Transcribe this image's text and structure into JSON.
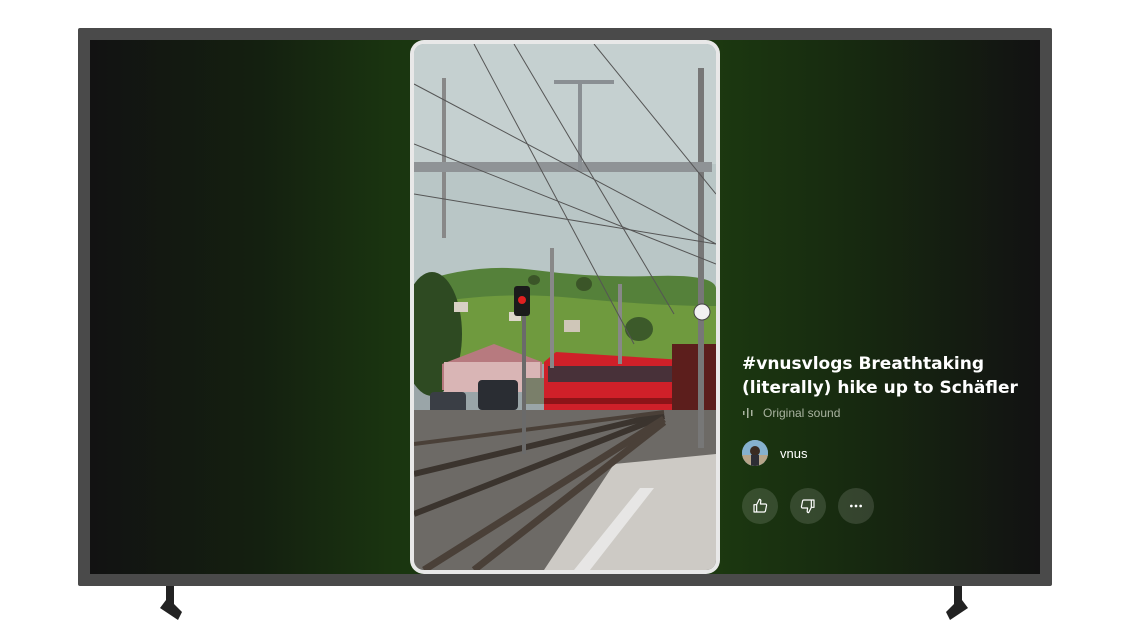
{
  "video": {
    "title": "#vnusvlogs Breathtaking (literally) hike up to Schäfler",
    "sound_label": "Original sound",
    "channel_name": "vnus"
  },
  "actions": {
    "like": "thumbs-up-icon",
    "dislike": "thumbs-down-icon",
    "more": "more-horizontal-icon"
  },
  "colors": {
    "screen_accent": "#1d3c10",
    "train_red": "#d8232a",
    "frame": "#4a4a4a"
  }
}
